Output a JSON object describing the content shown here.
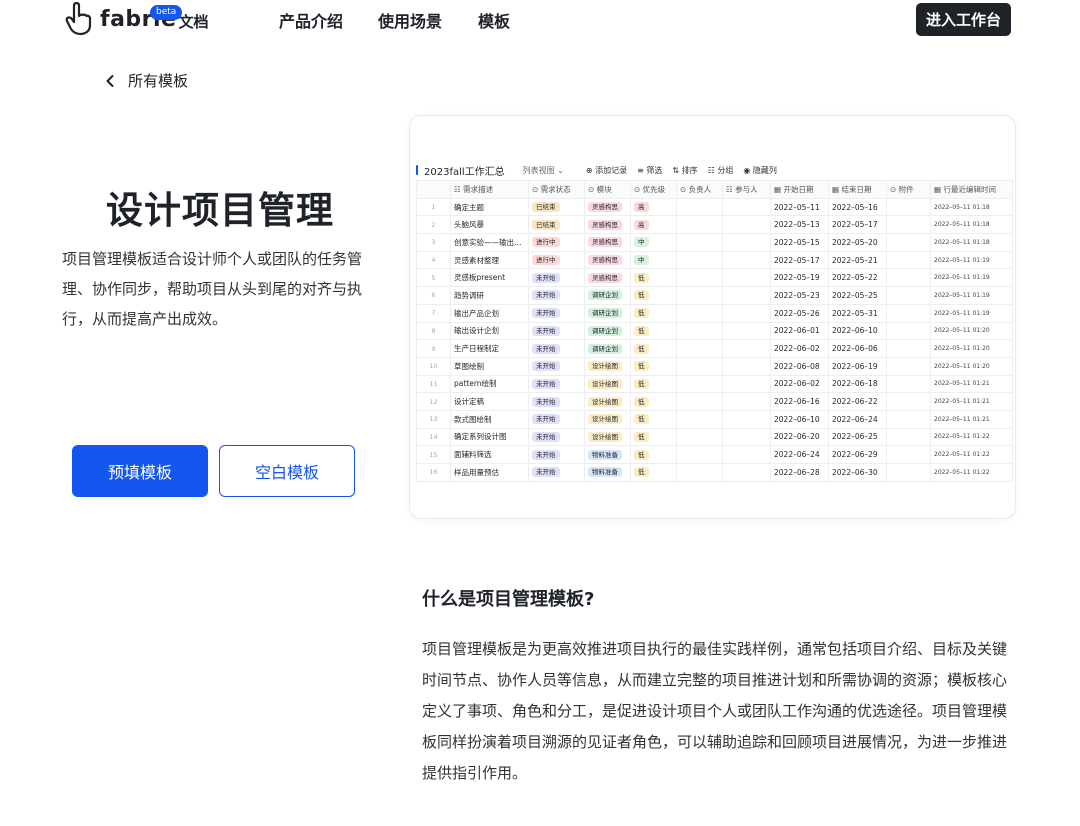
{
  "header": {
    "brand": "fabrie",
    "brand_cn": "文档",
    "beta": "beta",
    "nav": [
      "产品介绍",
      "使用场景",
      "模板"
    ],
    "cta": "进入工作台"
  },
  "breadcrumb": {
    "back_label": "所有模板"
  },
  "hero": {
    "title": "设计项目管理",
    "description": "项目管理模板适合设计师个人或团队的任务管理、协作同步，帮助项目从头到尾的对齐与执行，从而提高产出成效。",
    "primary_button": "预填模板",
    "secondary_button": "空白模板"
  },
  "preview": {
    "sheet_title": "2023fall工作汇总",
    "view": "列表视图",
    "toolbar": [
      "⊕ 添加记录",
      "≡ 筛选",
      "⇅ 排序",
      "☷ 分组",
      "◉ 隐藏列"
    ],
    "columns": [
      "需求描述",
      "需求状态",
      "模块",
      "优先级",
      "负责人",
      "参与人",
      "开始日期",
      "结束日期",
      "附件",
      "行最近编辑时间"
    ],
    "rows": [
      {
        "idx": "1",
        "desc": "确定主题",
        "status": "已结束",
        "module": "灵感构思",
        "priority": "高",
        "start": "2022–05–11",
        "end": "2022–05–16",
        "edited": "2022–05–11 01:18"
      },
      {
        "idx": "2",
        "desc": "头脑风暴",
        "status": "已结束",
        "module": "灵感构思",
        "priority": "高",
        "start": "2022–05–13",
        "end": "2022–05–17",
        "edited": "2022–05–11 01:18"
      },
      {
        "idx": "3",
        "desc": "创意实验——输出…",
        "status": "进行中",
        "module": "灵感构思",
        "priority": "中",
        "start": "2022–05–15",
        "end": "2022–05–20",
        "edited": "2022–05–11 01:18"
      },
      {
        "idx": "4",
        "desc": "灵感素材整理",
        "status": "进行中",
        "module": "灵感构思",
        "priority": "中",
        "start": "2022–05–17",
        "end": "2022–05–21",
        "edited": "2022–05–11 01:19"
      },
      {
        "idx": "5",
        "desc": "灵感板present",
        "status": "未开始",
        "module": "灵感构思",
        "priority": "低",
        "start": "2022–05–19",
        "end": "2022–05–22",
        "edited": "2022–05–11 01:19"
      },
      {
        "idx": "6",
        "desc": "趋势调研",
        "status": "未开始",
        "module": "调研企划",
        "priority": "低",
        "start": "2022–05–23",
        "end": "2022–05–25",
        "edited": "2022–05–11 01:19"
      },
      {
        "idx": "7",
        "desc": "输出产品企划",
        "status": "未开始",
        "module": "调研企划",
        "priority": "低",
        "start": "2022–05–26",
        "end": "2022–05–31",
        "edited": "2022–05–11 01:19"
      },
      {
        "idx": "8",
        "desc": "输出设计企划",
        "status": "未开始",
        "module": "调研企划",
        "priority": "低",
        "start": "2022–06–01",
        "end": "2022–06–10",
        "edited": "2022–05–11 01:20"
      },
      {
        "idx": "9",
        "desc": "生产日程制定",
        "status": "未开始",
        "module": "调研企划",
        "priority": "低",
        "start": "2022–06–02",
        "end": "2022–06–06",
        "edited": "2022–05–11 01:20"
      },
      {
        "idx": "10",
        "desc": "草图绘制",
        "status": "未开始",
        "module": "设计绘图",
        "priority": "低",
        "start": "2022–06–08",
        "end": "2022–06–19",
        "edited": "2022–05–11 01:20"
      },
      {
        "idx": "11",
        "desc": "pattern绘制",
        "status": "未开始",
        "module": "设计绘图",
        "priority": "低",
        "start": "2022–06–02",
        "end": "2022–06–18",
        "edited": "2022–05–11 01:21"
      },
      {
        "idx": "12",
        "desc": "设计定稿",
        "status": "未开始",
        "module": "设计绘图",
        "priority": "低",
        "start": "2022–06–16",
        "end": "2022–06–22",
        "edited": "2022–05–11 01:21"
      },
      {
        "idx": "13",
        "desc": "款式图绘制",
        "status": "未开始",
        "module": "设计绘图",
        "priority": "低",
        "start": "2022–06–10",
        "end": "2022–06–24",
        "edited": "2022–05–11 01:21"
      },
      {
        "idx": "14",
        "desc": "确定系列设计图",
        "status": "未开始",
        "module": "设计绘图",
        "priority": "低",
        "start": "2022–06–20",
        "end": "2022–06–25",
        "edited": "2022–05–11 01:22"
      },
      {
        "idx": "15",
        "desc": "面辅料筛选",
        "status": "未开始",
        "module": "物料准备",
        "priority": "低",
        "start": "2022–06–24",
        "end": "2022–06–29",
        "edited": "2022–05–11 01:22"
      },
      {
        "idx": "16",
        "desc": "样品用量预估",
        "status": "未开始",
        "module": "物料准备",
        "priority": "低",
        "start": "2022–06–28",
        "end": "2022–06–30",
        "edited": "2022–05–11 01:22"
      }
    ],
    "tag_colors": {
      "status": {
        "已结束": "#fbe6c4",
        "进行中": "#fdd9d6",
        "未开始": "#e1e0fb"
      },
      "module": {
        "灵感构思": "#fbd8e4",
        "调研企划": "#d3f0de",
        "设计绘图": "#fbecc7",
        "物料准备": "#d6e6fb"
      },
      "priority": {
        "高": "#fcd9d9",
        "中": "#d4f2dc",
        "低": "#fbecc4"
      }
    }
  },
  "article": {
    "heading": "什么是项目管理模板?",
    "body": "项目管理模板是为更高效推进项目执行的最佳实践样例，通常包括项目介绍、目标及关键时间节点、协作人员等信息，从而建立完整的项目推进计划和所需协调的资源；模板核心定义了事项、角色和分工，是促进设计项目个人或团队工作沟通的优选途径。项目管理模板同样扮演着项目溯源的见证者角色，可以辅助追踪和回顾项目进展情况，为进一步推进提供指引作用。"
  }
}
